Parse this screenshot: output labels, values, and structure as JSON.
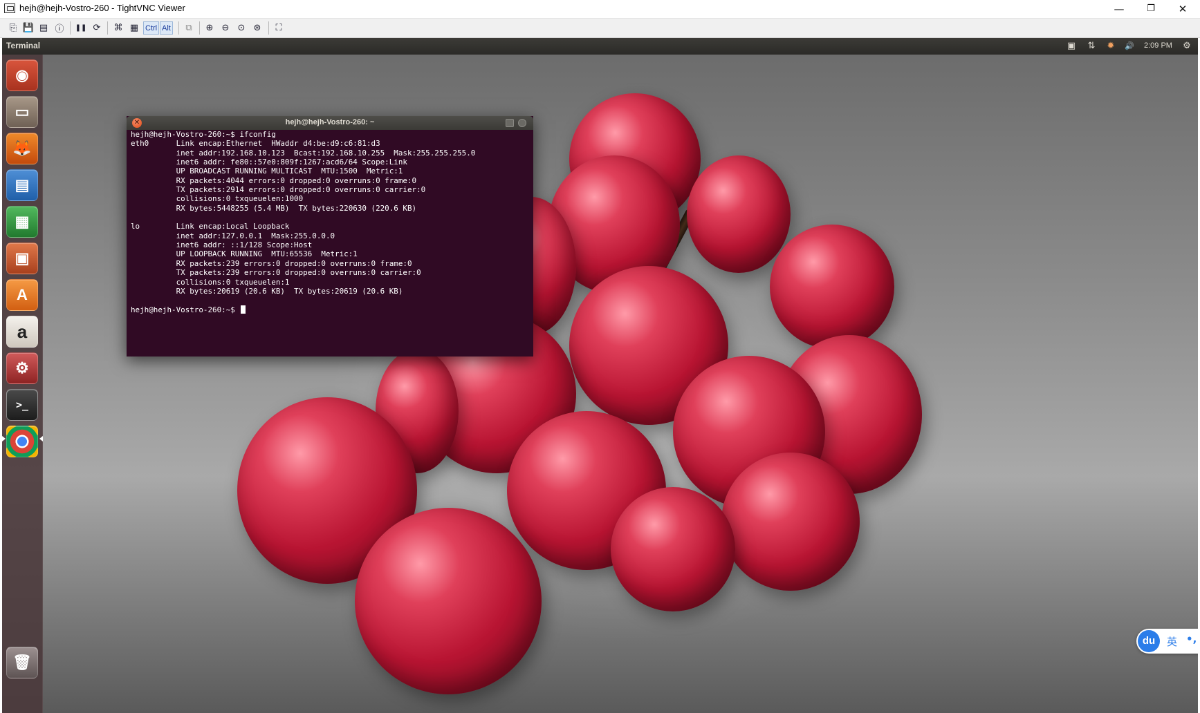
{
  "window": {
    "title": "hejh@hejh-Vostro-260 - TightVNC Viewer",
    "controls": {
      "minimize": "—",
      "restore": "❐",
      "close": "✕"
    }
  },
  "toolbar": {
    "buttons": [
      {
        "name": "new-connection",
        "glyph": "⎘"
      },
      {
        "name": "save-session",
        "glyph": "💾"
      },
      {
        "name": "connection-options",
        "glyph": "▤"
      },
      {
        "name": "connection-info",
        "glyph": "ⓘ"
      },
      {
        "name": "pause",
        "glyph": "❚❚"
      },
      {
        "name": "refresh",
        "glyph": "⟳"
      },
      {
        "name": "ctrl-alt-del",
        "glyph": "⌘"
      },
      {
        "name": "win-key",
        "glyph": "▦"
      },
      {
        "name": "transfer-files",
        "glyph": "⧉"
      },
      {
        "name": "zoom-in",
        "glyph": "⊕"
      },
      {
        "name": "zoom-out",
        "glyph": "⊖"
      },
      {
        "name": "zoom-100",
        "glyph": "⊙"
      },
      {
        "name": "zoom-auto",
        "glyph": "⊛"
      },
      {
        "name": "fullscreen",
        "glyph": "⛶"
      }
    ],
    "ctrl_label": "Ctrl",
    "alt_label": "Alt"
  },
  "panel": {
    "app_name": "Terminal",
    "indicators": [
      {
        "name": "display-indicator",
        "glyph": "▣"
      },
      {
        "name": "network-indicator",
        "glyph": "⇅"
      },
      {
        "name": "update-indicator",
        "glyph": "✹"
      },
      {
        "name": "volume-indicator",
        "glyph": "🔊"
      }
    ],
    "clock": "2:09 PM",
    "settings_glyph": "⚙"
  },
  "launcher": {
    "items": [
      {
        "name": "dash-home",
        "glyph": "◉",
        "color": "#c8503a"
      },
      {
        "name": "files",
        "glyph": "▭",
        "color": "#8c7a6b"
      },
      {
        "name": "firefox",
        "glyph": "🦊",
        "color": "#e66000"
      },
      {
        "name": "libreoffice-writer",
        "glyph": "▤",
        "color": "#2a6fb8"
      },
      {
        "name": "libreoffice-calc",
        "glyph": "▦",
        "color": "#2e9a3c"
      },
      {
        "name": "libreoffice-impress",
        "glyph": "▣",
        "color": "#c0522a"
      },
      {
        "name": "ubuntu-software-center",
        "glyph": "A",
        "color": "#e8741f"
      },
      {
        "name": "amazon",
        "glyph": "a",
        "color": "#ece8e2"
      },
      {
        "name": "system-settings",
        "glyph": "⚙",
        "color": "#b33a3a"
      },
      {
        "name": "terminal",
        "glyph": ">_",
        "color": "#2b2b2b"
      },
      {
        "name": "chrome",
        "glyph": "◎",
        "color": "#d6d6d6"
      },
      {
        "name": "trash",
        "glyph": "🗑",
        "color": "#7a6e6e"
      }
    ]
  },
  "terminal": {
    "title": "hejh@hejh-Vostro-260: ~",
    "close_glyph": "✕",
    "lines": [
      "hejh@hejh-Vostro-260:~$ ifconfig",
      "eth0      Link encap:Ethernet  HWaddr d4:be:d9:c6:81:d3",
      "          inet addr:192.168.10.123  Bcast:192.168.10.255  Mask:255.255.255.0",
      "          inet6 addr: fe80::57e0:809f:1267:acd6/64 Scope:Link",
      "          UP BROADCAST RUNNING MULTICAST  MTU:1500  Metric:1",
      "          RX packets:4044 errors:0 dropped:0 overruns:0 frame:0",
      "          TX packets:2914 errors:0 dropped:0 overruns:0 carrier:0",
      "          collisions:0 txqueuelen:1000",
      "          RX bytes:5448255 (5.4 MB)  TX bytes:220630 (220.6 KB)",
      "",
      "lo        Link encap:Local Loopback",
      "          inet addr:127.0.0.1  Mask:255.0.0.0",
      "          inet6 addr: ::1/128 Scope:Host",
      "          UP LOOPBACK RUNNING  MTU:65536  Metric:1",
      "          RX packets:239 errors:0 dropped:0 overruns:0 frame:0",
      "          TX packets:239 errors:0 dropped:0 overruns:0 carrier:0",
      "          collisions:0 txqueuelen:1",
      "          RX bytes:20619 (20.6 KB)  TX bytes:20619 (20.6 KB)",
      ""
    ],
    "prompt": "hejh@hejh-Vostro-260:~$ "
  },
  "ime": {
    "logo": "du",
    "lang": "英",
    "punct": "•,"
  }
}
